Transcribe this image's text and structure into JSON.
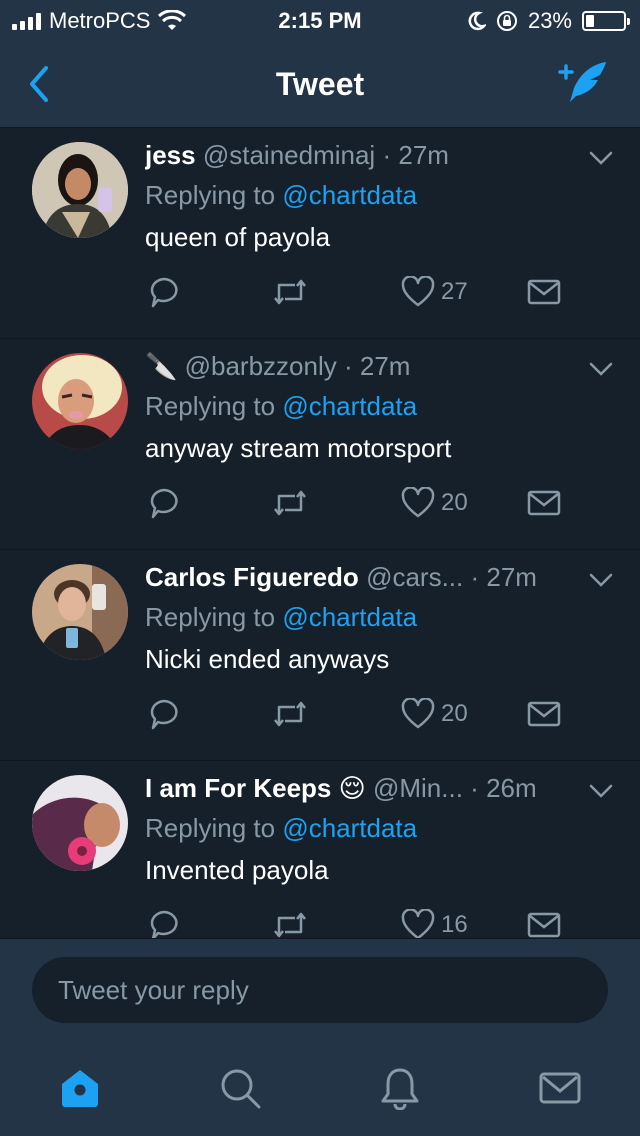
{
  "status_bar": {
    "carrier": "MetroPCS",
    "time": "2:15 PM",
    "battery_percent": "23%",
    "battery_level": 0.23,
    "icons": [
      "signal-icon",
      "wifi-icon",
      "moon-icon",
      "rotation-lock-icon",
      "battery-icon"
    ]
  },
  "nav": {
    "title": "Tweet",
    "back_icon": "chevron-left-icon",
    "compose_icon": "compose-tweet-icon"
  },
  "tweets": [
    {
      "name": "jess",
      "handle": "@stainedminaj",
      "dot": "·",
      "time": "27m",
      "reply_prefix": "Replying to",
      "reply_to": "@chartdata",
      "text": "queen of payola",
      "likes": "27"
    },
    {
      "name": "🔪",
      "handle": "@barbzzonly",
      "dot": "·",
      "time": "27m",
      "reply_prefix": "Replying to",
      "reply_to": "@chartdata",
      "text": "anyway stream motorsport",
      "likes": "20"
    },
    {
      "name": "Carlos Figueredo",
      "handle": "@cars...",
      "dot": "·",
      "time": "27m",
      "reply_prefix": "Replying to",
      "reply_to": "@chartdata",
      "text": "Nicki ended anyways",
      "likes": "20"
    },
    {
      "name": "I am For Keeps 😌",
      "handle": "@Min...",
      "dot": "·",
      "time": "26m",
      "reply_prefix": "Replying to",
      "reply_to": "@chartdata",
      "text": "Invented payola",
      "likes": "16"
    }
  ],
  "composer": {
    "placeholder": "Tweet your reply"
  },
  "tab_bar": {
    "items": [
      "home-icon",
      "search-icon",
      "notifications-icon",
      "messages-icon"
    ],
    "active": "home-icon"
  },
  "colors": {
    "background": "#15202b",
    "bar": "#243447",
    "accent": "#1da1f2",
    "secondary_text": "#8899a6"
  }
}
